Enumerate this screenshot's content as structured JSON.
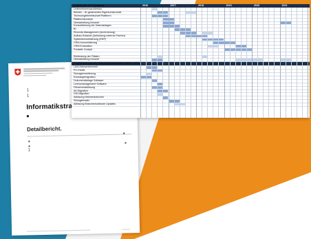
{
  "colors": {
    "teal": "#1e7fa6",
    "orange": "#ec8c1a",
    "header_navy": "#1b2f4a",
    "bar_blue": "#8ea9d1",
    "bar_light": "#c6d4ea"
  },
  "document": {
    "emblem": "swiss-cross-icon",
    "bullet": "1",
    "title": "Informatikstrateg",
    "marker": "■",
    "subtitle": "Detailbericht."
  },
  "roadmap": {
    "section1_title": "Projekt aus ICT Roadmap",
    "section2_title": "Projekt aus interner Planung Musterunternehmen 2016",
    "years": [
      "2016",
      "2017",
      "2018",
      "2019",
      "2020",
      "2021"
    ],
    "rows1": [
      {
        "label": "Unternehmensarchitektur",
        "bars": [
          [
            2,
            3,
            2
          ]
        ]
      },
      {
        "label": "Betrieb – ID-gesteuertes Eigentumsmodell",
        "bars": [
          [
            3,
            5,
            1
          ],
          [
            8,
            10,
            2
          ]
        ]
      },
      {
        "label": "Technologiebereitschaft Plattform",
        "bars": [
          [
            2,
            5,
            1
          ]
        ]
      },
      {
        "label": "Plattformkonzept",
        "bars": [
          [
            4,
            6,
            1
          ]
        ]
      },
      {
        "label": "Überarbeitung Intranet",
        "bars": [
          [
            4,
            6,
            1
          ],
          [
            25,
            27,
            1
          ]
        ]
      },
      {
        "label": "Konsolidierung der Datenablagen",
        "bars": [
          [
            4,
            7,
            1
          ]
        ]
      },
      {
        "label": "BI",
        "bars": [
          [
            6,
            9,
            1
          ]
        ]
      },
      {
        "label": "Records-Management (Archivierung)",
        "bars": [
          [
            7,
            10,
            1
          ],
          [
            11,
            13,
            2
          ]
        ]
      },
      {
        "label": "Aufbau Extranet (Anbindung externer Partner)",
        "bars": [
          [
            8,
            12,
            1
          ]
        ]
      },
      {
        "label": "Systemkonsolidierung (ERP)",
        "bars": [
          [
            11,
            15,
            1
          ]
        ]
      },
      {
        "label": "CRM-Konsolidierung",
        "bars": [
          [
            13,
            17,
            1
          ]
        ]
      },
      {
        "label": "CRM Evaluation",
        "bars": [
          [
            12,
            14,
            2
          ],
          [
            17,
            19,
            1
          ]
        ]
      },
      {
        "label": "Portable Cockpit",
        "bars": [
          [
            15,
            20,
            1
          ]
        ]
      },
      {
        "label": "",
        "bars": []
      },
      {
        "label": "Einbindung der Filialen",
        "bars": [
          [
            3,
            4,
            2
          ],
          [
            11,
            12,
            2
          ]
        ]
      },
      {
        "label": "Überarbeitung Intranet",
        "bars": [
          [
            2,
            4,
            1
          ],
          [
            17,
            22,
            2
          ],
          [
            25,
            27,
            2
          ]
        ]
      }
    ],
    "rows2": [
      {
        "label": "LAN-Netzwerkeinheit",
        "bars": [
          [
            1,
            3,
            1
          ]
        ]
      },
      {
        "label": "PC-Kredit",
        "bars": [
          [
            2,
            4,
            1
          ]
        ]
      },
      {
        "label": "Storageerweiterung",
        "bars": [
          [
            1,
            2,
            2
          ]
        ]
      },
      {
        "label": "Exchangemigration",
        "bars": [
          [
            0,
            2,
            1
          ]
        ]
      },
      {
        "label": "Dokumentablage Software",
        "bars": [
          [
            2,
            3,
            1
          ]
        ]
      },
      {
        "label": "Lizenzmanagement Software",
        "bars": [
          [
            3,
            4,
            1
          ]
        ]
      },
      {
        "label": "Fileserverablösung",
        "bars": [
          [
            2,
            4,
            1
          ]
        ]
      },
      {
        "label": "AV-Migration",
        "bars": [
          [
            3,
            5,
            1
          ]
        ]
      },
      {
        "label": "DSI-Migration",
        "bars": [
          [
            3,
            4,
            2
          ]
        ]
      },
      {
        "label": "Ablösung Netzwerkdrucker",
        "bars": [
          [
            4,
            5,
            1
          ]
        ]
      },
      {
        "label": "Storageersatz",
        "bars": [
          [
            5,
            7,
            1
          ]
        ]
      },
      {
        "label": "Ablösung Branchensoftware Updates",
        "bars": [
          [
            6,
            8,
            2
          ]
        ]
      }
    ]
  }
}
